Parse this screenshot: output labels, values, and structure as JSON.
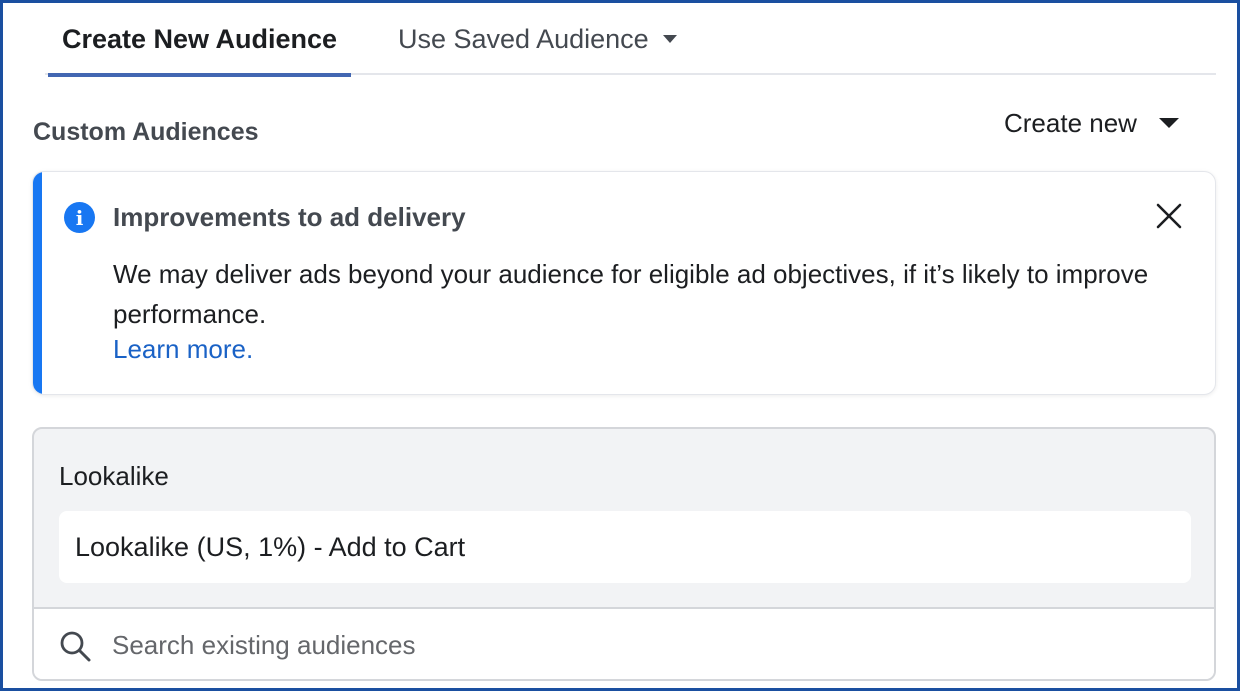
{
  "tabs": [
    {
      "label": "Create New Audience",
      "active": true
    },
    {
      "label": "Use Saved Audience",
      "active": false
    }
  ],
  "section": {
    "title": "Custom Audiences",
    "create_new_label": "Create new"
  },
  "banner": {
    "icon": "info-icon",
    "title": "Improvements to ad delivery",
    "body": "We may deliver ads beyond your audience for eligible ad objectives, if it’s likely to improve performance.",
    "link": "Learn more."
  },
  "lookalike": {
    "label": "Lookalike",
    "selected_audience": "Lookalike (US, 1%) - Add to Cart"
  },
  "search": {
    "value": "",
    "placeholder": "Search existing audiences"
  },
  "colors": {
    "accent": "#1877f2",
    "tab_underline": "#4267b2",
    "link": "#1a62c6",
    "frame_border": "#1a4fa0"
  }
}
